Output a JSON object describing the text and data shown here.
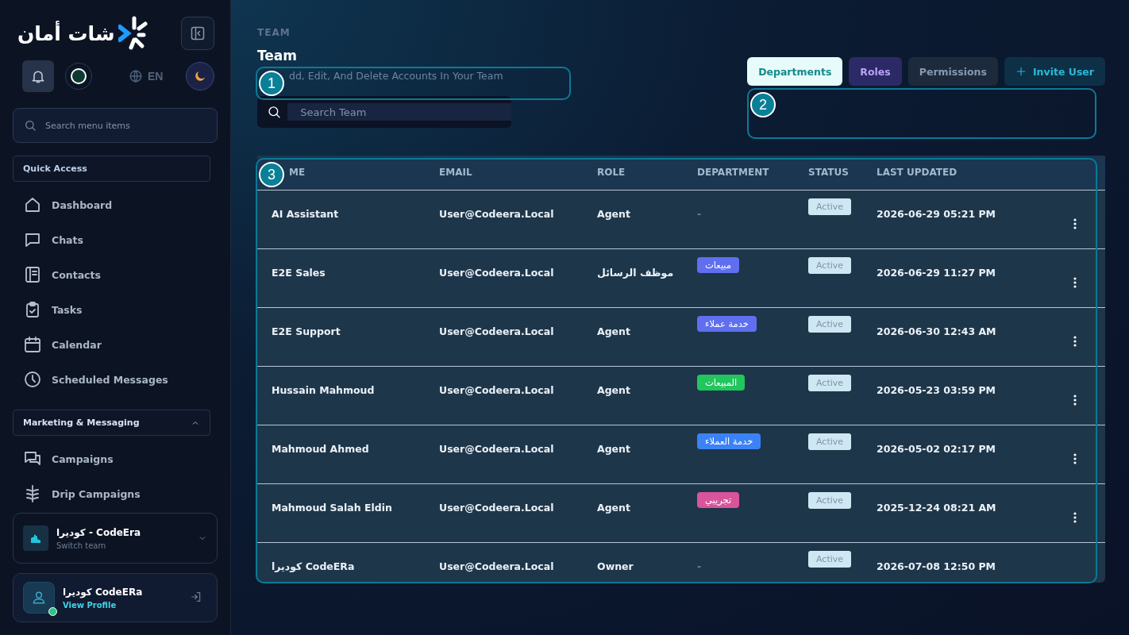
{
  "sidebar": {
    "logo": "شات أمان",
    "language": "EN",
    "search": {
      "placeholder": "Search menu items"
    },
    "sections": [
      {
        "title": "Quick Access",
        "items": [
          {
            "label": "Dashboard"
          },
          {
            "label": "Chats"
          },
          {
            "label": "Contacts"
          },
          {
            "label": "Tasks"
          },
          {
            "label": "Calendar"
          },
          {
            "label": "Scheduled Messages"
          }
        ]
      },
      {
        "title": "Marketing & Messaging",
        "expanded": true,
        "items": [
          {
            "label": "Campaigns"
          },
          {
            "label": "Drip Campaigns"
          }
        ]
      }
    ],
    "team": {
      "name": "كوديرا - CodeEra",
      "hint": "Switch team"
    },
    "profile": {
      "name": "كوديرا CodeERa",
      "link": "View Profile",
      "online": true
    }
  },
  "page": {
    "breadcrumb": "TEAM",
    "title": "Team",
    "subtitle": "dd, Edit, And Delete Accounts In Your Team",
    "search": {
      "placeholder": "Search Team"
    },
    "buttons": [
      {
        "label": "Departments",
        "kind": "light"
      },
      {
        "label": "Roles",
        "kind": "violet"
      },
      {
        "label": "Permissions",
        "kind": "muted"
      },
      {
        "label": "Invite User",
        "kind": "primary"
      }
    ]
  },
  "table": {
    "columns": [
      "ME",
      "EMAIL",
      "ROLE",
      "DEPARTMENT",
      "STATUS",
      "LAST UPDATED"
    ],
    "rows": [
      {
        "name": "AI Assistant",
        "email": "User@Codeera.Local",
        "role": "Agent",
        "department": null,
        "status": "Active",
        "updated": "2026-06-29 05:21 PM",
        "menu": true
      },
      {
        "name": "E2E Sales",
        "email": "User@Codeera.Local",
        "role": "موظف الرسائل",
        "department": {
          "label": "مبيعات",
          "color": "#5f6ff0"
        },
        "status": "Active",
        "updated": "2026-06-29 11:27 PM",
        "menu": true
      },
      {
        "name": "E2E Support",
        "email": "User@Codeera.Local",
        "role": "Agent",
        "department": {
          "label": "خدمة عملاء",
          "color": "#5f6ff0"
        },
        "status": "Active",
        "updated": "2026-06-30 12:43 AM",
        "menu": true
      },
      {
        "name": "Hussain Mahmoud",
        "email": "User@Codeera.Local",
        "role": "Agent",
        "department": {
          "label": "المبيعات",
          "color": "#22c55e"
        },
        "status": "Active",
        "updated": "2026-05-23 03:59 PM",
        "menu": true
      },
      {
        "name": "Mahmoud Ahmed",
        "email": "User@Codeera.Local",
        "role": "Agent",
        "department": {
          "label": "خدمة العملاء",
          "color": "#3b82f6"
        },
        "status": "Active",
        "updated": "2026-05-02 02:17 PM",
        "menu": true
      },
      {
        "name": "Mahmoud Salah Eldin",
        "email": "User@Codeera.Local",
        "role": "Agent",
        "department": {
          "label": "تجريبي",
          "color": "#d9549b"
        },
        "status": "Active",
        "updated": "2025-12-24 08:21 AM",
        "menu": true
      },
      {
        "name": "كوديرا CodeERa",
        "email": "User@Codeera.Local",
        "role": "Owner",
        "department": null,
        "status": "Active",
        "updated": "2026-07-08 12:50 PM",
        "menu": false
      }
    ]
  },
  "empty_department": "-",
  "callouts": [
    "1",
    "2",
    "3"
  ]
}
